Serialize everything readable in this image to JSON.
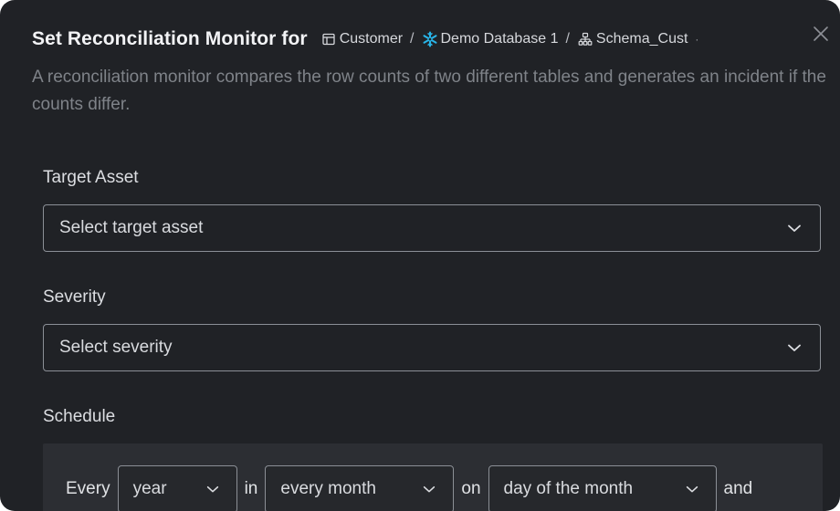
{
  "dialog": {
    "title": "Set Reconciliation Monitor for",
    "breadcrumbs": [
      {
        "icon": "table-icon",
        "label": "Customer"
      },
      {
        "icon": "snowflake-icon",
        "label": "Demo Database 1"
      },
      {
        "icon": "schema-icon",
        "label": "Schema_Cust"
      }
    ],
    "separator": "/",
    "overflow_marker": "·",
    "close_icon": "close-icon",
    "description": "A reconciliation monitor compares the row counts of two different tables and generates an incident if the counts differ."
  },
  "form": {
    "target_asset": {
      "label": "Target Asset",
      "placeholder": "Select target asset"
    },
    "severity": {
      "label": "Severity",
      "placeholder": "Select severity"
    },
    "schedule": {
      "label": "Schedule",
      "every_word": "Every",
      "in_word": "in",
      "on_word": "on",
      "and_word": "and",
      "period": "year",
      "month": "every month",
      "day": "day of the month"
    }
  },
  "colors": {
    "background": "#202226",
    "schedule_panel": "#2c2e33",
    "border": "#8b8f96",
    "snowflake_accent": "#29b5e8",
    "muted_text": "#7f8389"
  }
}
